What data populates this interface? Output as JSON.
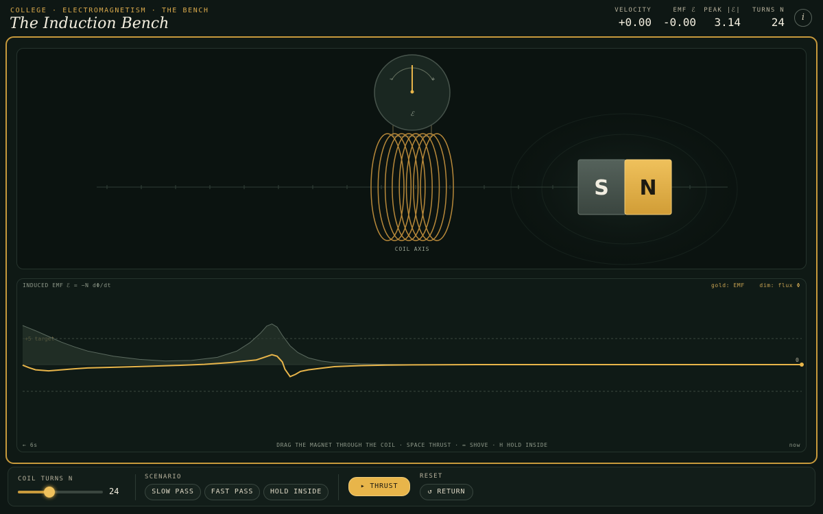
{
  "header": {
    "breadcrumb": "COLLEGE · ELECTROMAGNETISM · THE BENCH",
    "title": "The Induction Bench",
    "stats": [
      {
        "label": "VELOCITY",
        "value": "+0.00"
      },
      {
        "label": "EMF ℰ",
        "value": "-0.00"
      },
      {
        "label": "PEAK |ℰ|",
        "value": "3.14"
      },
      {
        "label": "TURNS N",
        "value": "24"
      }
    ],
    "info_icon": "i"
  },
  "stage": {
    "galvanometer_symbol": "ℰ",
    "galvanometer_minus": "−",
    "galvanometer_plus": "+",
    "coil_label": "COIL AXIS",
    "magnet_left_pole": "S",
    "magnet_right_pole": "N"
  },
  "plot": {
    "title": "INDUCED EMF",
    "formula": "ℰ = −N dΦ/dt",
    "legend_text": "gold: EMF    dim: flux Φ",
    "target_label": "+5 target",
    "current_value": "0",
    "left_time": "← 6s",
    "hint": "DRAG THE MAGNET THROUGH THE COIL · SPACE THRUST · ↔ SHOVE · H HOLD INSIDE",
    "right_time": "now"
  },
  "controls": {
    "turns_label": "COIL TURNS N",
    "turns_value": "24",
    "turns_fraction": 0.37,
    "scenario_label": "SCENARIO",
    "scenarios": [
      "SLOW PASS",
      "FAST PASS",
      "HOLD INSIDE"
    ],
    "thrust_label": "▸ THRUST",
    "reset_label": "RESET",
    "return_label": "↺ RETURN"
  },
  "colors": {
    "accent_gold": "#e8b54a",
    "frame_gold": "#c89a3c",
    "background": "#0e1714",
    "coil": "#b8893a"
  },
  "chart_data": {
    "type": "line",
    "x_range_seconds": [
      -6,
      0
    ],
    "y_range": [
      -5,
      5
    ],
    "target": 5,
    "series": [
      {
        "name": "EMF",
        "x": [
          -6,
          -5.95,
          -5.9,
          -5.8,
          -5.7,
          -5.6,
          -5.5,
          -5.2,
          -5.0,
          -4.8,
          -4.6,
          -4.4,
          -4.2,
          -4.08,
          -4.04,
          -4.0,
          -3.98,
          -3.94,
          -3.9,
          -3.86,
          -3.8,
          -3.7,
          -3.6,
          -3.4,
          -3.2,
          -3.0,
          -2.5,
          -2.0,
          -1.0,
          0
        ],
        "y": [
          -0.1,
          -0.6,
          -1.0,
          -1.2,
          -1.0,
          -0.8,
          -0.65,
          -0.45,
          -0.3,
          -0.15,
          0.05,
          0.4,
          0.9,
          1.9,
          1.6,
          0.5,
          -0.9,
          -2.3,
          -1.9,
          -1.3,
          -1.0,
          -0.7,
          -0.4,
          -0.2,
          -0.1,
          -0.05,
          0,
          0,
          0,
          0
        ]
      },
      {
        "name": "flux Φ",
        "x": [
          -6,
          -5.95,
          -5.9,
          -5.8,
          -5.7,
          -5.6,
          -5.5,
          -5.3,
          -5.1,
          -4.9,
          -4.7,
          -4.5,
          -4.35,
          -4.25,
          -4.17,
          -4.12,
          -4.08,
          -4.04,
          -4.0,
          -3.94,
          -3.88,
          -3.8,
          -3.7,
          -3.6,
          -3.4,
          -3.2,
          -3.0
        ],
        "y": [
          7.5,
          7.0,
          6.5,
          5.4,
          4.3,
          3.4,
          2.6,
          1.6,
          1.0,
          0.7,
          0.8,
          1.4,
          2.6,
          4.2,
          6.0,
          7.4,
          7.8,
          7.2,
          5.6,
          3.6,
          2.3,
          1.3,
          0.7,
          0.35,
          0.15,
          0.05,
          0
        ]
      }
    ]
  }
}
